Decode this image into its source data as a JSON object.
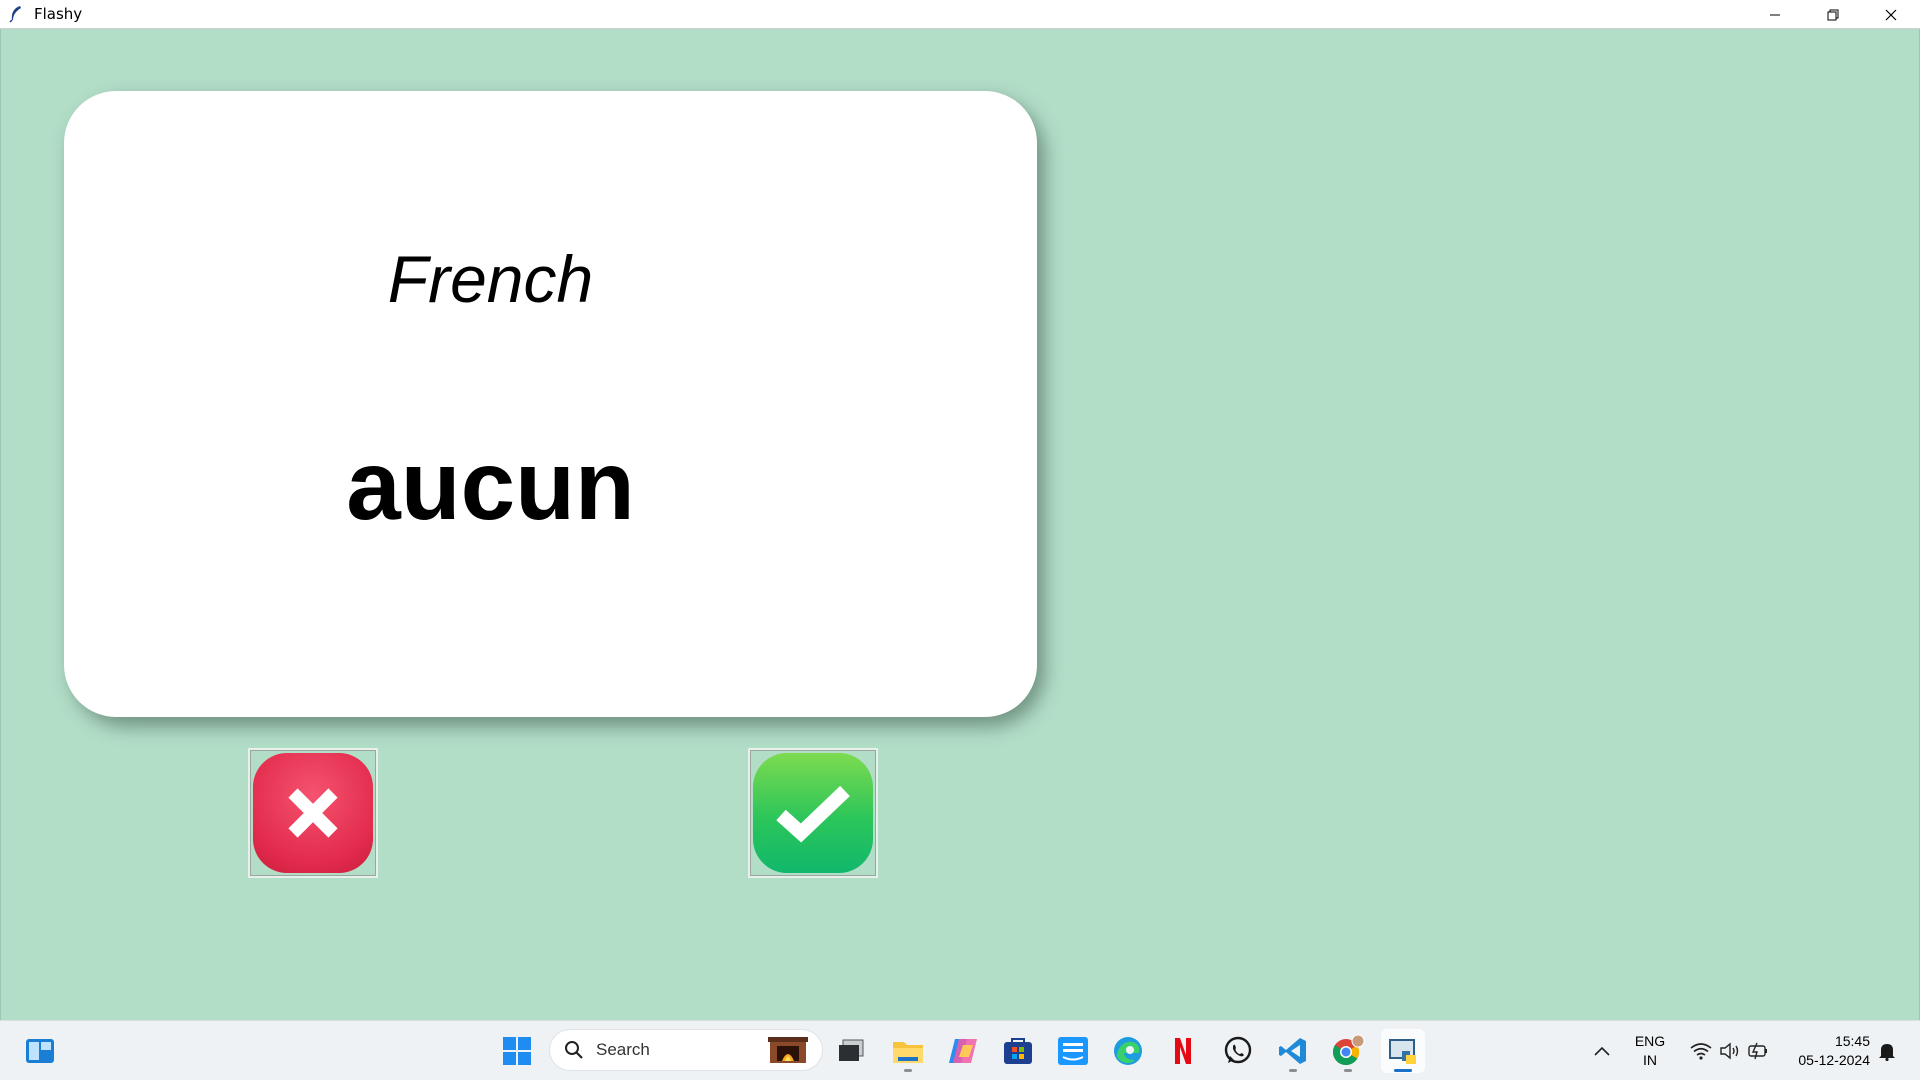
{
  "window": {
    "title": "Flashy"
  },
  "card": {
    "language": "French",
    "word": "aucun"
  },
  "buttons": {
    "wrong": "wrong-button",
    "right": "right-button"
  },
  "taskbar": {
    "search_placeholder": "Search",
    "language": "ENG",
    "region": "IN",
    "time": "15:45",
    "date": "05-12-2024"
  },
  "colors": {
    "background": "#b2ddc7",
    "card": "#ffffff",
    "wrong": "#e22a4c",
    "right": "#2bc55a"
  }
}
